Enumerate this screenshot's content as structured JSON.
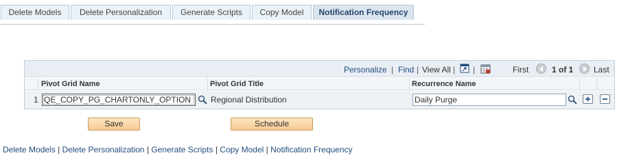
{
  "tabs": [
    {
      "label": "Delete Models"
    },
    {
      "label": "Delete Personalization"
    },
    {
      "label": "Generate Scripts"
    },
    {
      "label": "Copy Model"
    },
    {
      "label": "Notification Frequency"
    }
  ],
  "active_tab": "Notification Frequency",
  "grid": {
    "toolbar": {
      "personalize": "Personalize",
      "find": "Find",
      "view_all": "View All",
      "sep": "|",
      "first": "First",
      "page_range": "1 of 1",
      "last": "Last"
    },
    "columns": [
      "Pivot Grid Name",
      "Pivot Grid Title",
      "Recurrence Name"
    ],
    "rows": [
      {
        "num": "1",
        "pivot_grid_name": "QE_COPY_PG_CHARTONLY_OPTION",
        "pivot_grid_title": "Regional Distribution",
        "recurrence_name": "Daily Purge"
      }
    ]
  },
  "buttons": {
    "save": "Save",
    "schedule": "Schedule"
  },
  "footer_links": [
    "Delete Models",
    "Delete Personalization",
    "Generate Scripts",
    "Copy Model",
    "Notification Frequency"
  ],
  "colors": {
    "link": "#1f4b7d",
    "tab_bg": "#eaf2f7",
    "active_tab_bg": "#d9e5ef",
    "button_bg": "#f6c98f"
  }
}
